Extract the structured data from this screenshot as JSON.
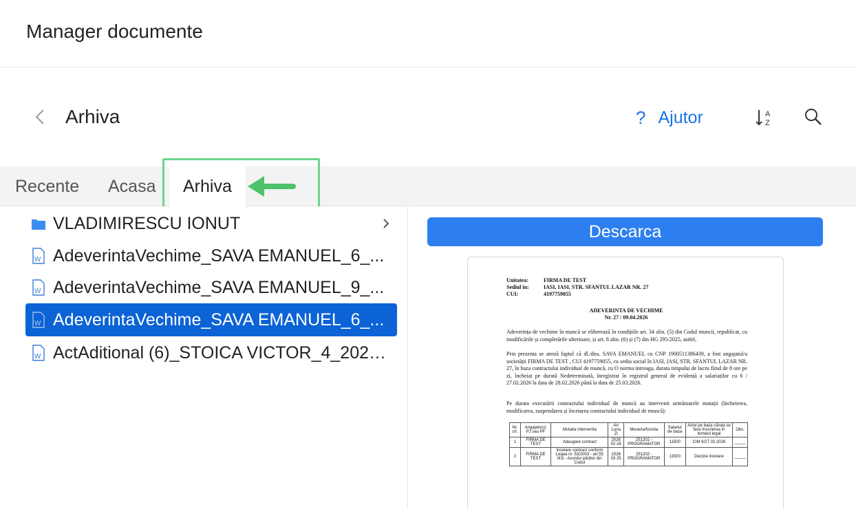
{
  "app": {
    "title": "Manager documente"
  },
  "header": {
    "title": "Arhiva",
    "help_label": "Ajutor",
    "sort_glyph_a": "A",
    "sort_glyph_z": "Z"
  },
  "tabs": [
    {
      "label": "Recente"
    },
    {
      "label": "Acasa"
    },
    {
      "label": "Arhiva"
    }
  ],
  "files": [
    {
      "name": "VLADIMIRESCU IONUT",
      "type": "folder"
    },
    {
      "name": "AdeverintaVechime_SAVA EMANUEL_6_...",
      "type": "word"
    },
    {
      "name": "AdeverintaVechime_SAVA EMANUEL_9_...",
      "type": "word"
    },
    {
      "name": "AdeverintaVechime_SAVA EMANUEL_6_...",
      "type": "word",
      "selected": true
    },
    {
      "name": "ActAditional (6)_STOICA VICTOR_4_2026...",
      "type": "word"
    }
  ],
  "preview": {
    "download_label": "Descarca",
    "doc": {
      "unit_label": "Unitatea:",
      "unit_value": "FIRMA DE TEST",
      "seat_label": "Sediul în:",
      "seat_value": "IASI, IASI, STR. SFANTUL LAZAR NR. 27",
      "cui_label": "CUI:",
      "cui_value": "4197759055",
      "heading": "ADEVERINTA DE VECHIME",
      "number": "Nr. 27 / 09.04.2026",
      "para1": "Adeverința de vechime în muncă se eliberează în condițiile art. 34 alin. (5) din Codul muncii, republicat, cu modificările și completările ulterioare, și art. 8 alin. (6) și (7) din HG 295/2025, astfel,",
      "para2": "Prin prezenta se atestă faptul că dl./dna. SAVA EMANUEL cu CNP 1900511386439, a fost angajatul/a societății FIRMA DE TEST , CUI 4197759055, cu sediu social în IASI, IASI, STR. SFANTUL LAZAR NR. 27, în baza contractului individual de muncă, cu O norma intreaga, durata timpului de lucru fiind de 8 ore pe zi, încheiat pe durată Nedeterminată, înregistrat în registrul general de evidență a salariaților cu 6 / 27.02.2026 la data de 28.02.2026 până la data de 25.03.2026.",
      "para3": "Pe durata executării contractului individual de muncă au intervenit următoarele mutații (încheierea, modificarea, suspendarea și încetarea contractului individual de muncă):",
      "table_headers": [
        "Nr. crt.",
        "Angajatorul, PJ sau PF",
        "Mutatia intervenita",
        "An Luna Zi",
        "Meseria/functia",
        "Salariul de baza",
        "Actul pe baza căruia se face înscrierea în temeiul legal",
        "Obs."
      ],
      "table_rows": [
        [
          "1",
          "FIRMA DE TEST",
          "Adaugare contract",
          "2026 02 28",
          "251202 - PROGRAMATOR",
          "11500",
          "CIM 6/27.02.2026",
          "_____"
        ],
        [
          "2",
          "FIRMA DE TEST",
          "Incetare contract conform Legea nr. 53/2003 - art.55 lit.b - Acordul părților din Codul",
          "2026 03 25",
          "251202 - PROGRAMATOR",
          "11500",
          "Decizie incetare",
          "_____"
        ]
      ]
    }
  },
  "colors": {
    "accent": "#1a73e8",
    "selected": "#0b63d6",
    "download": "#2d7ff0",
    "highlight": "#6fd58a",
    "folder": "#3b8ef0"
  }
}
